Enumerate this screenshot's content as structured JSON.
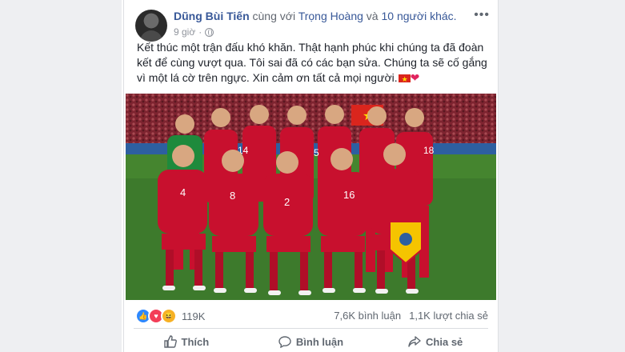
{
  "post": {
    "author": "Dũng Bùi Tiến",
    "with_text": "cùng với",
    "tagged": "Trọng Hoàng",
    "and_text": "và",
    "others": "10 người khác.",
    "time": "9 giờ",
    "more_icon": "more-icon",
    "text": "Kết thúc một trận đấu khó khăn. Thật hạnh phúc khi chúng ta đã đoàn kết để cùng vượt qua. Tôi sai đã có các bạn sửa. Chúng ta sẽ cố gắng vì một lá cờ trên ngực. Xin cảm ơn tất cả mọi người.",
    "emoji_heart": "❤"
  },
  "photo": {
    "jersey_numbers": [
      "4",
      "8",
      "2",
      "16",
      "18",
      "14",
      "5",
      "6"
    ]
  },
  "engagement": {
    "reactions_count": "119K",
    "comments": "7,6K bình luận",
    "shares": "1,1K lượt chia sẻ"
  },
  "actions": {
    "like": "Thích",
    "comment": "Bình luận",
    "share": "Chia sẻ"
  },
  "colors": {
    "link": "#385898",
    "muted": "#606770",
    "jersey": "#c8102e",
    "pitch": "#3d7a2c"
  }
}
